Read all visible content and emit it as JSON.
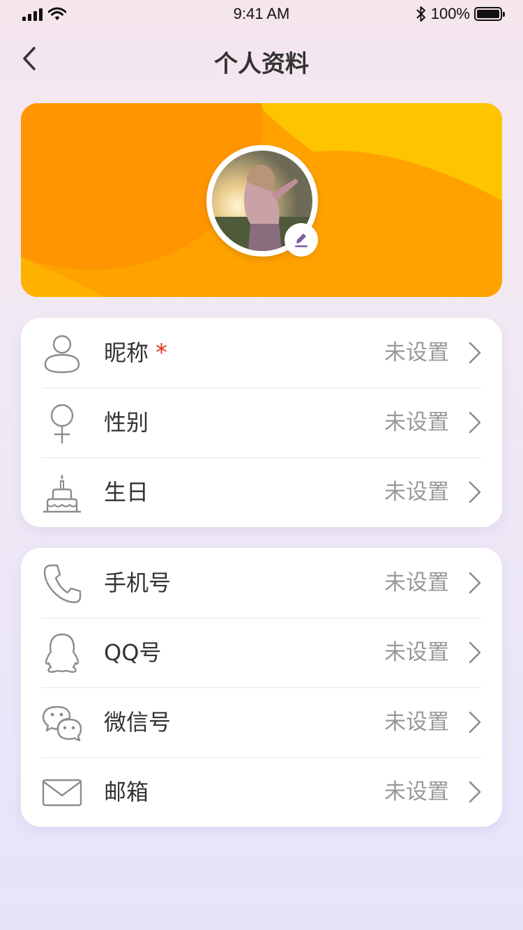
{
  "status_bar": {
    "time": "9:41 AM",
    "battery": "100%"
  },
  "nav": {
    "title": "个人资料",
    "back_icon": "chevron-left-icon"
  },
  "profile": {
    "edit_icon": "pencil-icon"
  },
  "basic_info": [
    {
      "label": "昵称",
      "value": "未设置",
      "required": true,
      "required_mark": "*",
      "icon": "user-icon"
    },
    {
      "label": "性别",
      "value": "未设置",
      "required": false,
      "icon": "female-icon"
    },
    {
      "label": "生日",
      "value": "未设置",
      "required": false,
      "icon": "cake-icon"
    }
  ],
  "contact_info": [
    {
      "label": "手机号",
      "value": "未设置",
      "icon": "phone-icon"
    },
    {
      "label": "QQ号",
      "value": "未设置",
      "icon": "qq-icon"
    },
    {
      "label": "微信号",
      "value": "未设置",
      "icon": "wechat-icon"
    },
    {
      "label": "邮箱",
      "value": "未设置",
      "icon": "mail-icon"
    }
  ],
  "colors": {
    "banner_orange": "#ffa200",
    "banner_yellow": "#ffc400",
    "banner_dark_orange": "#ff8f00",
    "required_red": "#e0331a",
    "value_gray": "#999999",
    "icon_gray": "#8c8c8c"
  }
}
